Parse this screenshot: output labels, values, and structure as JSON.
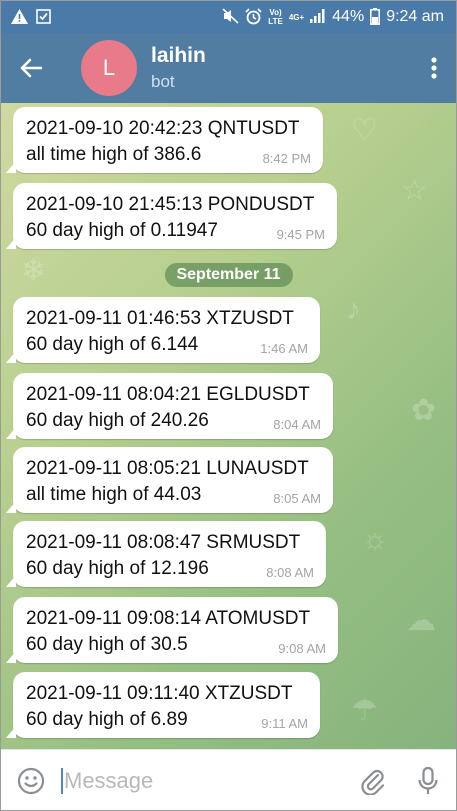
{
  "status_bar": {
    "battery": "44%",
    "time": "9:24 am",
    "volte_line1": "Vo)",
    "volte_line2": "LTE",
    "network": "4G+",
    "icons": [
      "warning-icon",
      "checkbox-icon",
      "mute-icon",
      "alarm-icon",
      "signal-icon",
      "battery-icon"
    ]
  },
  "header": {
    "avatar_letter": "L",
    "title": "laihin",
    "subtitle": "bot",
    "colors": {
      "bar": "#517da2",
      "avatar": "#e97a8a"
    }
  },
  "chat": {
    "date_separator": "September 11",
    "messages": [
      {
        "text": "2021-09-10 20:42:23 QNTUSDT\nall time high of 386.6",
        "time": "8:42 PM"
      },
      {
        "text": "2021-09-10 21:45:13 PONDUSDT\n60 day high of 0.11947",
        "time": "9:45 PM"
      },
      {
        "text": "2021-09-11 01:46:53 XTZUSDT\n60 day high of 6.144",
        "time": "1:46 AM"
      },
      {
        "text": "2021-09-11 08:04:21 EGLDUSDT\n60 day high of 240.26",
        "time": "8:04 AM"
      },
      {
        "text": "2021-09-11 08:05:21 LUNAUSDT\nall time high of 44.03",
        "time": "8:05 AM"
      },
      {
        "text": "2021-09-11 08:08:47 SRMUSDT\n60 day high of 12.196",
        "time": "8:08 AM"
      },
      {
        "text": "2021-09-11 09:08:14 ATOMUSDT\n60 day high of 30.5",
        "time": "9:08 AM"
      },
      {
        "text": "2021-09-11 09:11:40 XTZUSDT\n60 day high of 6.89",
        "time": "9:11 AM"
      }
    ]
  },
  "composer": {
    "placeholder": "Message"
  }
}
